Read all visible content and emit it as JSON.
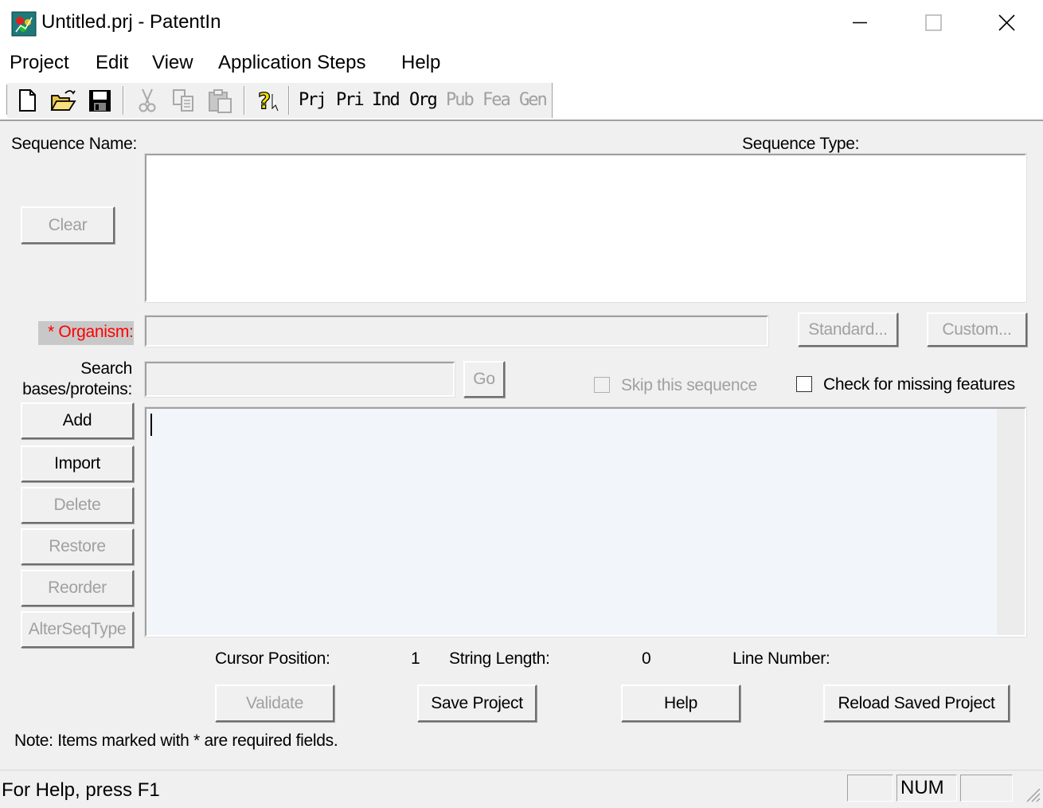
{
  "window": {
    "title": "Untitled.prj - PatentIn",
    "icon": "patentin-app-icon"
  },
  "menu": [
    "Project",
    "Edit",
    "View",
    "Application Steps",
    "Help"
  ],
  "toolbar": {
    "icons": [
      "new-file-icon",
      "open-folder-icon",
      "save-disk-icon",
      "cut-icon",
      "copy-icon",
      "paste-icon",
      "help-pointer-icon"
    ],
    "steps": [
      {
        "label": "Prj",
        "enabled": true
      },
      {
        "label": "Pri",
        "enabled": true
      },
      {
        "label": "Ind",
        "enabled": true
      },
      {
        "label": "Org",
        "enabled": true
      },
      {
        "label": "Pub",
        "enabled": false
      },
      {
        "label": "Fea",
        "enabled": false
      },
      {
        "label": "Gen",
        "enabled": false
      }
    ]
  },
  "form": {
    "sequence_name_label": "Sequence Name:",
    "sequence_type_label": "Sequence Type:",
    "clear_button": "Clear",
    "organism_required_marker": "*",
    "organism_label": "Organism:",
    "organism_value": "",
    "standard_button": "Standard...",
    "custom_button": "Custom...",
    "search_label_line1": "Search",
    "search_label_line2": "bases/proteins:",
    "search_value": "",
    "go_button": "Go",
    "skip_sequence_label": "Skip this sequence",
    "skip_sequence_checked": false,
    "check_missing_label": "Check for missing features",
    "check_missing_checked": false,
    "side_buttons": {
      "add": "Add",
      "import": "Import",
      "delete": "Delete",
      "restore": "Restore",
      "reorder": "Reorder",
      "alterseqtype": "AlterSeqType"
    },
    "sequence_text": ""
  },
  "info": {
    "cursor_position_label": "Cursor Position:",
    "cursor_position_value": "1",
    "string_length_label": "String Length:",
    "string_length_value": "0",
    "line_number_label": "Line Number:",
    "line_number_value": ""
  },
  "actions": {
    "validate": "Validate",
    "save_project": "Save Project",
    "help": "Help",
    "reload_saved_project": "Reload Saved Project"
  },
  "note": "Note: Items marked with * are required fields.",
  "status": {
    "help_text": "For Help, press F1",
    "num_indicator": "NUM"
  }
}
